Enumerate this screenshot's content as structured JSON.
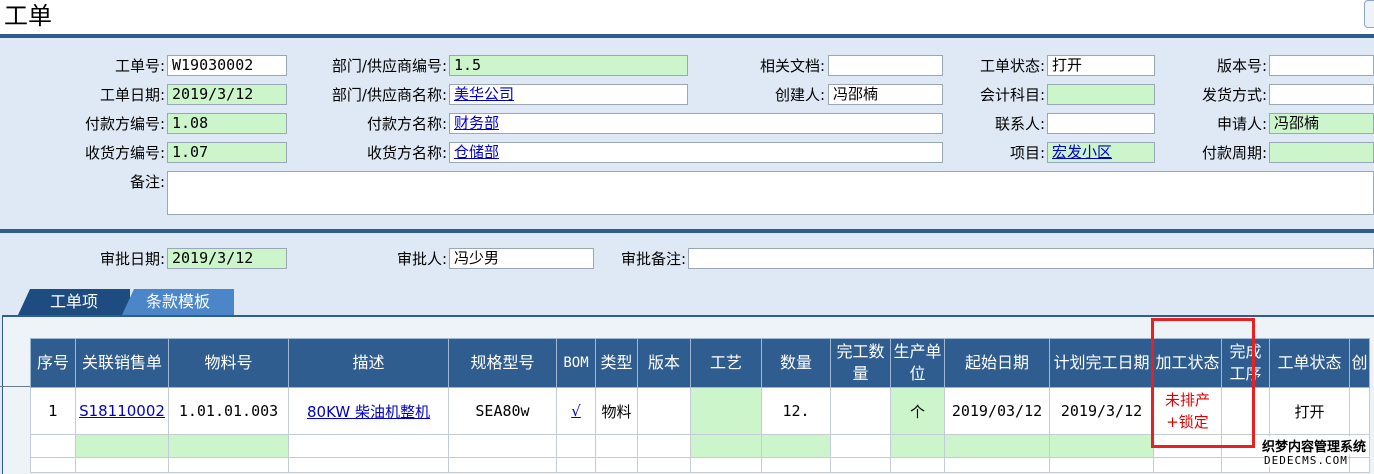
{
  "page": {
    "title": "工单"
  },
  "header_form": {
    "order_no": {
      "label": "工单号:",
      "value": "W19030002"
    },
    "order_date": {
      "label": "工单日期:",
      "value": "2019/3/12"
    },
    "payer_code": {
      "label": "付款方编号:",
      "value": "1.08"
    },
    "receiver_code": {
      "label": "收货方编号:",
      "value": "1.07"
    },
    "remarks": {
      "label": "备注:",
      "value": ""
    },
    "dept_code": {
      "label": "部门/供应商编号:",
      "value": "1.5"
    },
    "dept_name": {
      "label": "部门/供应商名称:",
      "value": "美华公司"
    },
    "payer_name": {
      "label": "付款方名称:",
      "value": "财务部"
    },
    "receiver_name": {
      "label": "收货方名称:",
      "value": "仓储部"
    },
    "related_doc": {
      "label": "相关文档:",
      "value": ""
    },
    "creator": {
      "label": "创建人:",
      "value": "冯邵楠"
    },
    "order_status": {
      "label": "工单状态:",
      "value": "打开"
    },
    "account_subject": {
      "label": "会计科目:",
      "value": ""
    },
    "contact": {
      "label": "联系人:",
      "value": ""
    },
    "project": {
      "label": "项目:",
      "value": "宏发小区"
    },
    "version_no": {
      "label": "版本号:",
      "value": ""
    },
    "ship_method": {
      "label": "发货方式:",
      "value": ""
    },
    "applicant": {
      "label": "申请人:",
      "value": "冯邵楠"
    },
    "pay_cycle": {
      "label": "付款周期:",
      "value": ""
    }
  },
  "approval_form": {
    "approve_date": {
      "label": "审批日期:",
      "value": "2019/3/12"
    },
    "approver": {
      "label": "审批人:",
      "value": "冯少男"
    },
    "approve_note": {
      "label": "审批备注:",
      "value": ""
    }
  },
  "tabs": [
    {
      "label": "工单项",
      "active": true
    },
    {
      "label": "条款模板",
      "active": false
    }
  ],
  "grid": {
    "columns": [
      "序号",
      "关联销售单",
      "物料号",
      "描述",
      "规格型号",
      "BOM",
      "类型",
      "版本",
      "工艺",
      "数量",
      "完工数量",
      "生产单位",
      "起始日期",
      "计划完工日期",
      "加工状态",
      "完成工序",
      "工单状态",
      "创"
    ],
    "rows": [
      {
        "seq": "1",
        "sales_order": "S18110002",
        "material_no": "1.01.01.003",
        "description": "80KW 柴油机整机",
        "spec": "SEA80w",
        "bom": "√",
        "type": "物料",
        "version": "",
        "process": "",
        "qty": "12.",
        "done_qty": "",
        "unit": "个",
        "start_date": "2019/03/12",
        "plan_end_date": "2019/3/12",
        "proc_status_1": "未排产",
        "proc_status_2": "+锁定",
        "done_step": "",
        "order_status": "打开"
      }
    ]
  },
  "watermark": {
    "line1": "织梦内容管理系统",
    "line2": "DEDECMS.COM"
  },
  "colors": {
    "header_bar": "#2f5d8f",
    "green_field": "#ccf5cc",
    "highlight": "#e82020"
  }
}
